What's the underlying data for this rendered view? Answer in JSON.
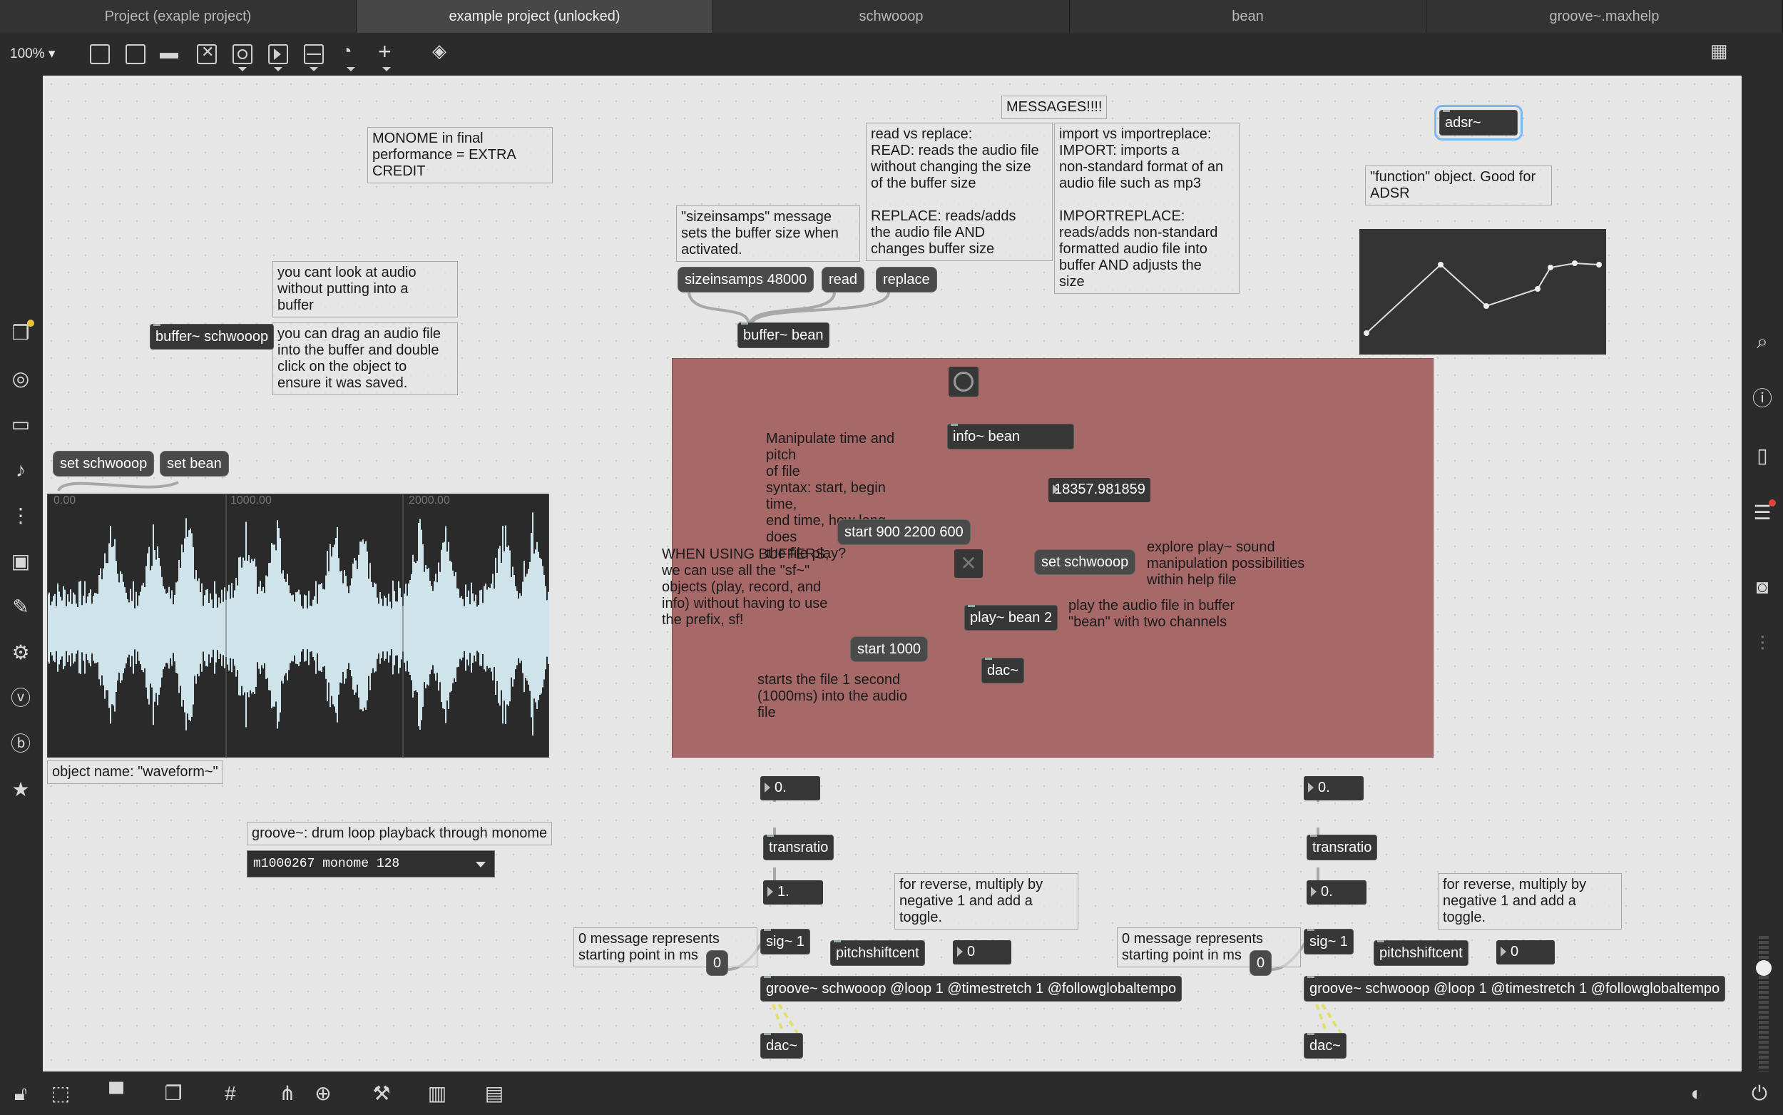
{
  "tabs": [
    "Project (exaple project)",
    "example project (unlocked)",
    "schwooop",
    "bean",
    "groove~.maxhelp"
  ],
  "toolbar": {
    "zoom": "100%"
  },
  "comments": {
    "monome": "MONOME in final\nperformance = EXTRA\nCREDIT",
    "messages": "MESSAGES!!!!",
    "read_replace": "read vs replace:\nREAD: reads the audio file\nwithout changing the size\nof the buffer size\n\nREPLACE: reads/adds\nthe audio file AND\nchanges buffer size",
    "import": "import vs importreplace:\nIMPORT: imports a\nnon-standard format of an\naudio file such as mp3\n\nIMPORTREPLACE:\nreads/adds non-standard\nformatted audio file into\nbuffer AND adjusts the\nsize",
    "function": "\"function\" object. Good for\nADSR",
    "sizeinsamps": "\"sizeinsamps\" message\nsets the buffer size when\nactivated.",
    "cant_look": "you cant look at audio\nwithout putting into a\nbuffer",
    "drag": "you can drag an audio file\ninto the buffer and double\nclick on the object to\nensure it was saved.",
    "manipulate": "Manipulate time and pitch\nof file\nsyntax: start, begin time,\nend time, how long does\nthe file play?",
    "when_using": "WHEN USING BUFFERS,\nwe can use all the \"sf~\"\nobjects (play, record, and\ninfo) without having to use\nthe prefix, sf!",
    "explore": "explore play~ sound\nmanipulation possibilities\nwithin help file",
    "play_audio": "play the audio file in buffer\n\"bean\" with two channels",
    "starts": "starts the file 1 second\n(1000ms) into the audio\nfile",
    "waveform_name": "object name: \"waveform~\"",
    "groove_title": "groove~: drum loop playback through monome",
    "reverse_1": "for reverse, multiply by\nnegative 1 and add a\ntoggle.",
    "reverse_2": "for reverse, multiply by\nnegative 1 and add a\ntoggle.",
    "zero_msg_1": "0 message represents\nstarting point in ms",
    "zero_msg_2": "0 message represents\nstarting point in ms"
  },
  "objects": {
    "adsr": "adsr~",
    "buffer_schwooop": "buffer~ schwooop",
    "buffer_bean": "buffer~ bean",
    "info_bean": "info~ bean",
    "play_bean": "play~ bean 2",
    "dac_main": "dac~",
    "transratio_1": "transratio",
    "transratio_2": "transratio",
    "sig_1": "sig~ 1",
    "sig_2": "sig~ 1",
    "pitchshift_1": "pitchshiftcent",
    "pitchshift_2": "pitchshiftcent",
    "groove_1": "groove~ schwooop @loop 1 @timestretch 1 @followglobaltempo",
    "groove_2": "groove~ schwooop @loop 1 @timestretch 1 @followglobaltempo",
    "dac_1": "dac~",
    "dac_2": "dac~"
  },
  "messages": {
    "sizeinsamps": "sizeinsamps 48000",
    "read": "read",
    "replace": "replace",
    "set_schwooop": "set schwooop",
    "set_bean": "set bean",
    "start_900": "start 900 2200 600",
    "set_schwooop_2": "set schwooop",
    "start_1000": "start 1000",
    "zero_1": "0",
    "zero_2": "0"
  },
  "numbers": {
    "info_out": "18357.981859",
    "trans_in_1": "0.",
    "trans_out_1": "1.",
    "pitch_val_1": "0",
    "trans_in_2": "0.",
    "trans_out_2": "0.",
    "pitch_val_2": "0"
  },
  "waveform_ticks": [
    "0.00",
    "1000.00",
    "2000.00"
  ],
  "umenu": {
    "selected": "m1000267 monome 128"
  },
  "colors": {
    "panel": "#a76868",
    "canvas": "#e6e6e6",
    "waveform_fill": "#cfe3ea"
  }
}
